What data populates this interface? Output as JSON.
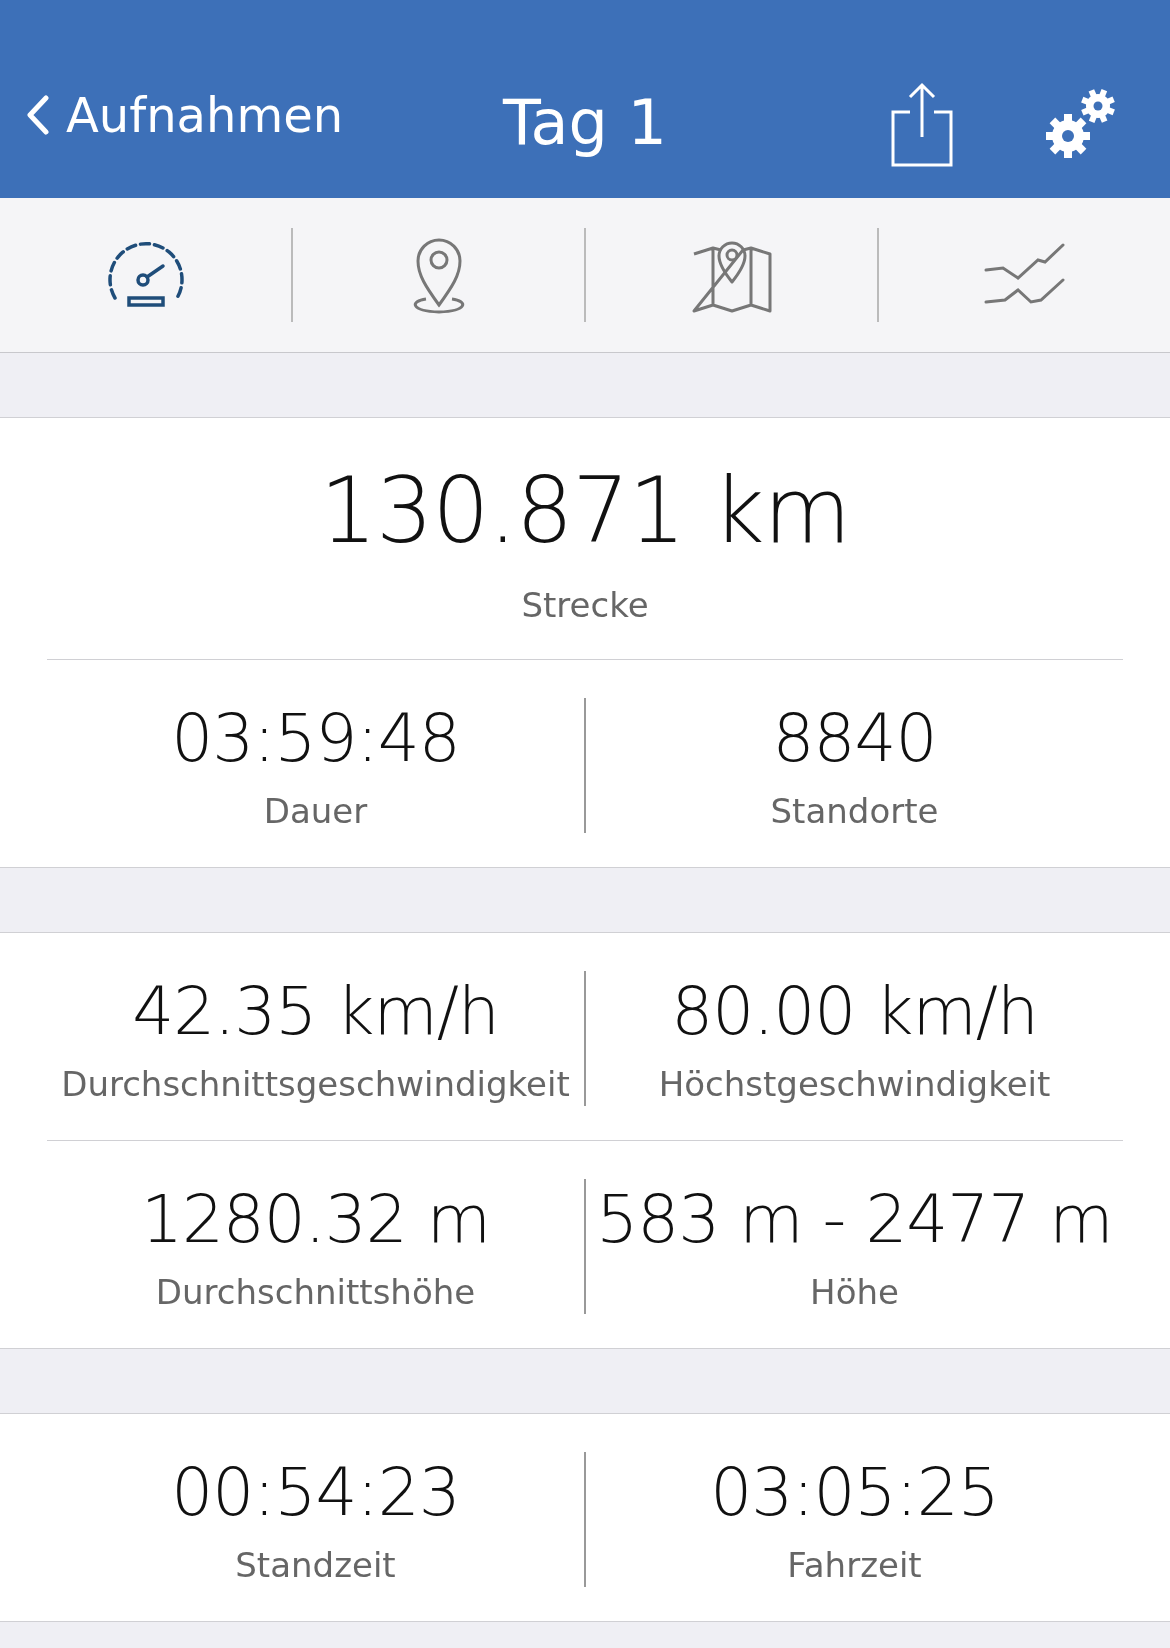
{
  "nav": {
    "back_label": "Aufnahmen",
    "title": "Tag 1"
  },
  "tabs": [
    {
      "kind": "speedometer",
      "selected": true
    },
    {
      "kind": "location",
      "selected": false
    },
    {
      "kind": "map",
      "selected": false
    },
    {
      "kind": "chart",
      "selected": false
    }
  ],
  "sections": [
    {
      "rows": [
        {
          "items": [
            {
              "value": "130.871 km",
              "label": "Strecke"
            }
          ]
        },
        {
          "items": [
            {
              "value": "03:59:48",
              "label": "Dauer"
            },
            {
              "value": "8840",
              "label": "Standorte"
            }
          ]
        }
      ]
    },
    {
      "rows": [
        {
          "items": [
            {
              "value": "42.35 km/h",
              "label": "Durchschnittsgeschwindigkeit"
            },
            {
              "value": "80.00 km/h",
              "label": "Höchstgeschwindigkeit"
            }
          ]
        },
        {
          "items": [
            {
              "value": "1280.32 m",
              "label": "Durchschnittshöhe"
            },
            {
              "value": "583 m - 2477 m",
              "label": "Höhe"
            }
          ]
        }
      ]
    },
    {
      "rows": [
        {
          "items": [
            {
              "value": "00:54:23",
              "label": "Standzeit"
            },
            {
              "value": "03:05:25",
              "label": "Fahrzeit"
            }
          ]
        }
      ]
    }
  ]
}
